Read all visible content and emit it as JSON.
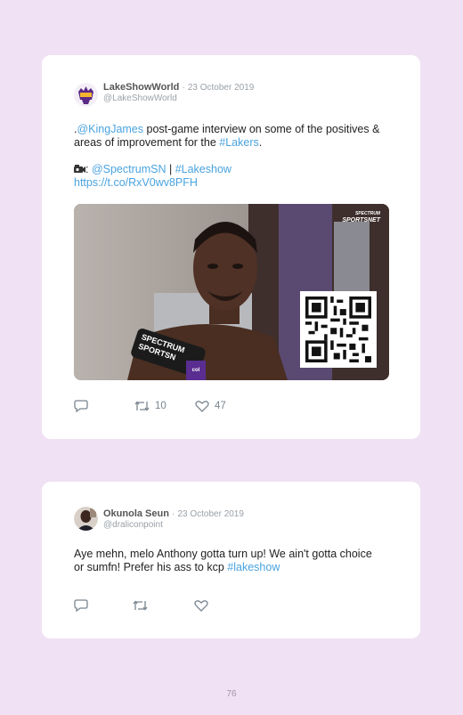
{
  "colors": {
    "background": "#f0e2f4",
    "link": "#4aa3df",
    "card": "#ffffff"
  },
  "tweets": [
    {
      "name": "LakeShowWorld",
      "separator": "·",
      "date": "23 October 2019",
      "handle": "@LakeShowWorld",
      "line1_prefix": ".",
      "mention": "@KingJames",
      "line1_text": " post-game interview on some of the positives & areas of improvement for the ",
      "hashtag1": "#Lakers",
      "line1_end": ".",
      "credit_icon": "camera-icon",
      "credit_colon": ": ",
      "credit_mention": "@SpectrumSN",
      "credit_pipe": " | ",
      "credit_hashtag": "#Lakeshow",
      "url": "https://t.co/RxV0wv8PFH",
      "media": {
        "logo_line1": "SPECTRUM",
        "logo_line2": "SPORTSNET",
        "mic_text": "SPECTRUM SPORTSN",
        "mic_extra": "col"
      },
      "retweets": "10",
      "likes": "47"
    },
    {
      "name": "Okunola Seun",
      "separator": "·",
      "date": "23 October 2019",
      "handle": "@draliconpoint",
      "text": "Aye mehn, melo Anthony gotta turn up! We ain't gotta choice or sumfn! Prefer his ass to kcp ",
      "hashtag": "#lakeshow",
      "retweets": "",
      "likes": ""
    }
  ],
  "page_number": "76"
}
